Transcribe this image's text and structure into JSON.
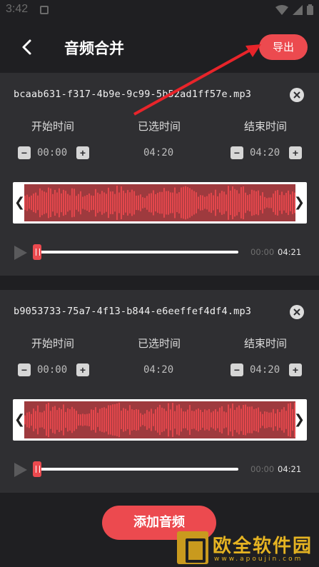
{
  "status_bar": {
    "time": "3:42"
  },
  "header": {
    "title": "音频合并",
    "export_label": "导出"
  },
  "cards": [
    {
      "filename": "bcaab631-f317-4b9e-9c99-5b52ad1ff57e.mp3",
      "start_label": "开始时间",
      "selected_label": "已选时间",
      "end_label": "结束时间",
      "start_time": "00:00",
      "selected_time": "04:20",
      "end_time": "04:20",
      "current_time": "00:00",
      "total_time": "04:21",
      "progress": 0.0
    },
    {
      "filename": "b9053733-75a7-4f13-b844-e6eeffef4df4.mp3",
      "start_label": "开始时间",
      "selected_label": "已选时间",
      "end_label": "结束时间",
      "start_time": "00:00",
      "selected_time": "04:20",
      "end_time": "04:20",
      "current_time": "00:00",
      "total_time": "04:21",
      "progress": 0.0
    }
  ],
  "stepper": {
    "minus": "−",
    "plus": "+"
  },
  "waveform": {
    "handle_left": "❮",
    "handle_right": "❯"
  },
  "add_audio_label": "添加音频",
  "watermark": {
    "text": "欧全软件园",
    "url": "www.apoujin.com"
  },
  "colors": {
    "accent": "#ec4a4f",
    "background": "#1f1f22",
    "card": "#2f2f32",
    "wave_bar": "#e4474c"
  },
  "icons": {
    "back": "chevron-left-icon",
    "close": "close-icon",
    "play": "play-icon",
    "annotation": "red-arrow-icon"
  }
}
